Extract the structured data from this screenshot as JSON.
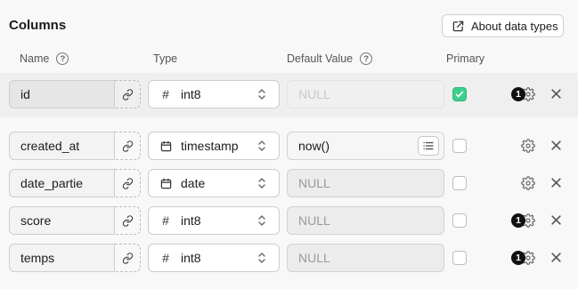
{
  "section": {
    "title": "Columns",
    "about_label": "About data types"
  },
  "headers": {
    "name": "Name",
    "type": "Type",
    "default": "Default Value",
    "primary": "Primary"
  },
  "help_glyph": "?",
  "columns": [
    {
      "name": "id",
      "type": "int8",
      "type_icon": "hash-icon",
      "default": "NULL",
      "primary": true,
      "badge": "1"
    },
    {
      "name": "created_at",
      "type": "timestamp",
      "type_icon": "calendar-icon",
      "default": "now()",
      "primary": false
    },
    {
      "name": "date_partie",
      "type": "date",
      "type_icon": "calendar-icon",
      "default": "NULL",
      "primary": false
    },
    {
      "name": "score",
      "type": "int8",
      "type_icon": "hash-icon",
      "default": "NULL",
      "primary": false,
      "badge": "1"
    },
    {
      "name": "temps",
      "type": "int8",
      "type_icon": "hash-icon",
      "default": "NULL",
      "primary": false,
      "badge": "1"
    }
  ],
  "colors": {
    "primary_check": "#3ecf8e",
    "badge": "#111111",
    "row_highlight": "#efefef"
  }
}
